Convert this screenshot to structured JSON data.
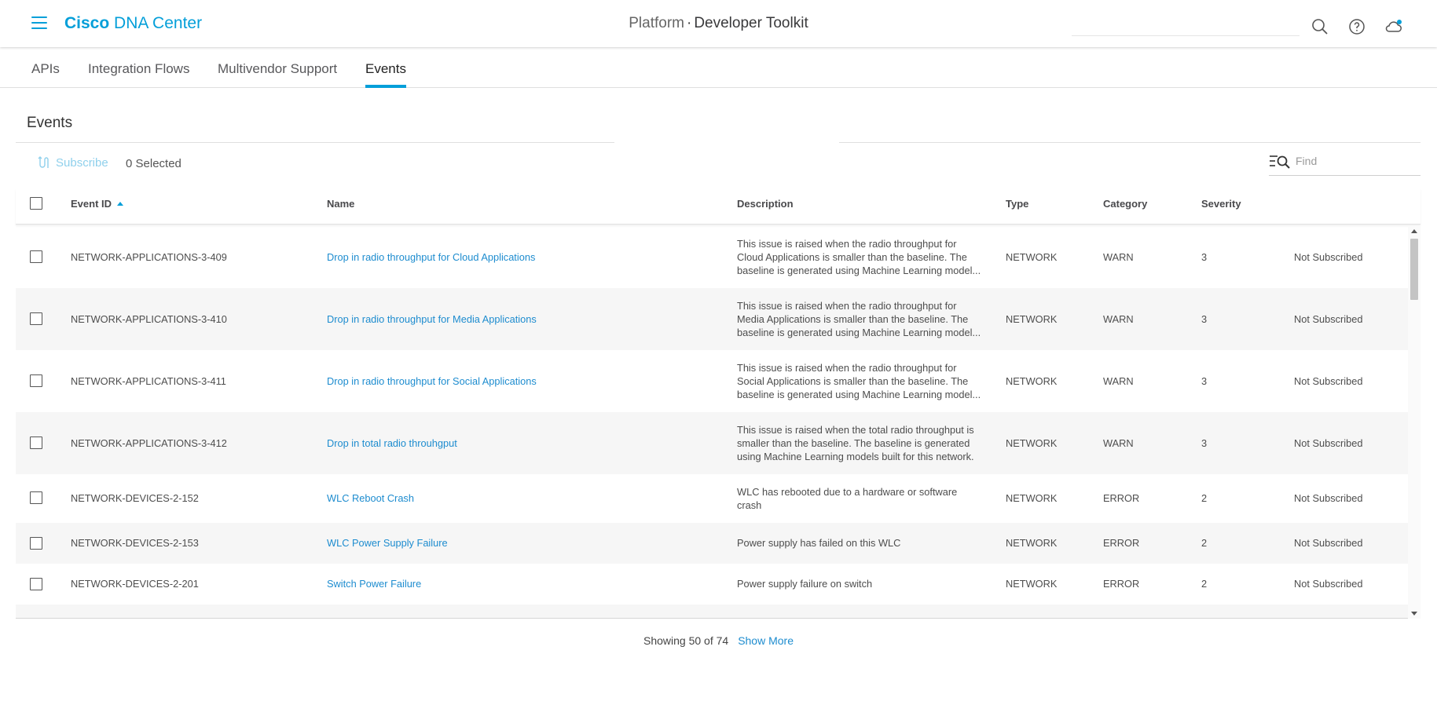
{
  "header": {
    "brand_bold": "Cisco",
    "brand_rest": "DNA Center",
    "breadcrumb": "Platform",
    "separator": "·",
    "title": "Developer Toolkit",
    "icons": [
      "menu-icon",
      "search-icon",
      "help-icon",
      "cloud-notification-icon"
    ]
  },
  "tabs": [
    {
      "label": "APIs",
      "active": false
    },
    {
      "label": "Integration Flows",
      "active": false
    },
    {
      "label": "Multivendor Support",
      "active": false
    },
    {
      "label": "Events",
      "active": true
    }
  ],
  "section": {
    "title": "Events"
  },
  "toolbar": {
    "subscribe_label": "Subscribe",
    "selected_label": "0 Selected",
    "find_placeholder": "Find"
  },
  "table": {
    "columns": {
      "event_id": "Event ID",
      "name": "Name",
      "description": "Description",
      "type": "Type",
      "category": "Category",
      "severity": "Severity"
    },
    "sort": {
      "column": "Event ID",
      "direction": "ascending"
    },
    "rows": [
      {
        "id": "NETWORK-APPLICATIONS-3-409",
        "name": "Drop in radio throughput for Cloud Applications",
        "desc": [
          "This issue is raised when the radio throughput for",
          "Cloud Applications is smaller than the baseline. The",
          "baseline is generated using Machine Learning model..."
        ],
        "type": "NETWORK",
        "category": "WARN",
        "severity": "3",
        "status": "Not Subscribed"
      },
      {
        "id": "NETWORK-APPLICATIONS-3-410",
        "name": "Drop in radio throughput for Media Applications",
        "desc": [
          "This issue is raised when the radio throughput for",
          "Media Applications is smaller than the baseline. The",
          "baseline is generated using Machine Learning model..."
        ],
        "type": "NETWORK",
        "category": "WARN",
        "severity": "3",
        "status": "Not Subscribed"
      },
      {
        "id": "NETWORK-APPLICATIONS-3-411",
        "name": "Drop in radio throughput for Social Applications",
        "desc": [
          "This issue is raised when the radio throughput for",
          "Social Applications is smaller than the baseline. The",
          "baseline is generated using Machine Learning model..."
        ],
        "type": "NETWORK",
        "category": "WARN",
        "severity": "3",
        "status": "Not Subscribed"
      },
      {
        "id": "NETWORK-APPLICATIONS-3-412",
        "name": "Drop in total radio throuhgput",
        "desc": [
          "This issue is raised when the total radio throughput is",
          "smaller than the baseline. The baseline is generated",
          "using Machine Learning models built for this network."
        ],
        "type": "NETWORK",
        "category": "WARN",
        "severity": "3",
        "status": "Not Subscribed"
      },
      {
        "id": "NETWORK-DEVICES-2-152",
        "name": "WLC Reboot Crash",
        "desc": [
          "WLC has rebooted due to a hardware or software",
          "crash"
        ],
        "type": "NETWORK",
        "category": "ERROR",
        "severity": "2",
        "status": "Not Subscribed"
      },
      {
        "id": "NETWORK-DEVICES-2-153",
        "name": "WLC Power Supply Failure",
        "desc": [
          "Power supply has failed on this WLC"
        ],
        "type": "NETWORK",
        "category": "ERROR",
        "severity": "2",
        "status": "Not Subscribed"
      },
      {
        "id": "NETWORK-DEVICES-2-201",
        "name": "Switch Power Failure",
        "desc": [
          "Power supply failure on switch"
        ],
        "type": "NETWORK",
        "category": "ERROR",
        "severity": "2",
        "status": "Not Subscribed"
      }
    ]
  },
  "footer": {
    "showing": "Showing 50 of 74",
    "show_more": "Show More"
  },
  "colors": {
    "accent": "#049fd9",
    "link": "#1d8ccf",
    "subscribe_disabled": "#8fd0ec"
  }
}
